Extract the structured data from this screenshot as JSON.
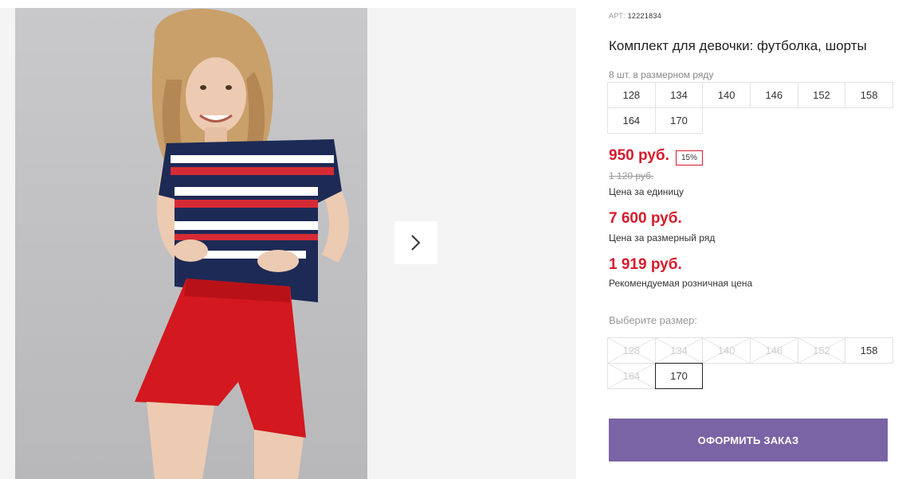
{
  "product": {
    "article_label": "АРТ:",
    "article_number": "12221834",
    "title": "Комплект для девочки: футболка, шорты",
    "size_row_note": "8 шт. в размерном ряду",
    "size_row": [
      "128",
      "134",
      "140",
      "146",
      "152",
      "158",
      "164",
      "170"
    ]
  },
  "pricing": {
    "unit_price": "950 руб.",
    "discount": "15%",
    "old_price": "1 120 руб.",
    "unit_caption": "Цена за единицу",
    "row_price": "7 600 руб.",
    "row_caption": "Цена за размерный ряд",
    "retail_price": "1 919 руб.",
    "retail_caption": "Рекомендуемая розничная цена"
  },
  "size_picker": {
    "label": "Выберите размер:",
    "sizes": [
      {
        "label": "128",
        "available": false
      },
      {
        "label": "134",
        "available": false
      },
      {
        "label": "140",
        "available": false
      },
      {
        "label": "146",
        "available": false
      },
      {
        "label": "152",
        "available": false
      },
      {
        "label": "158",
        "available": true
      },
      {
        "label": "164",
        "available": false
      },
      {
        "label": "170",
        "available": true,
        "selected": true
      }
    ]
  },
  "order_button_label": "ОФОРМИТЬ ЗАКАЗ",
  "colors": {
    "price_red": "#d51b2c",
    "button_purple": "#7a64a5"
  },
  "icons": {
    "gallery_next": "chevron-right-icon"
  }
}
